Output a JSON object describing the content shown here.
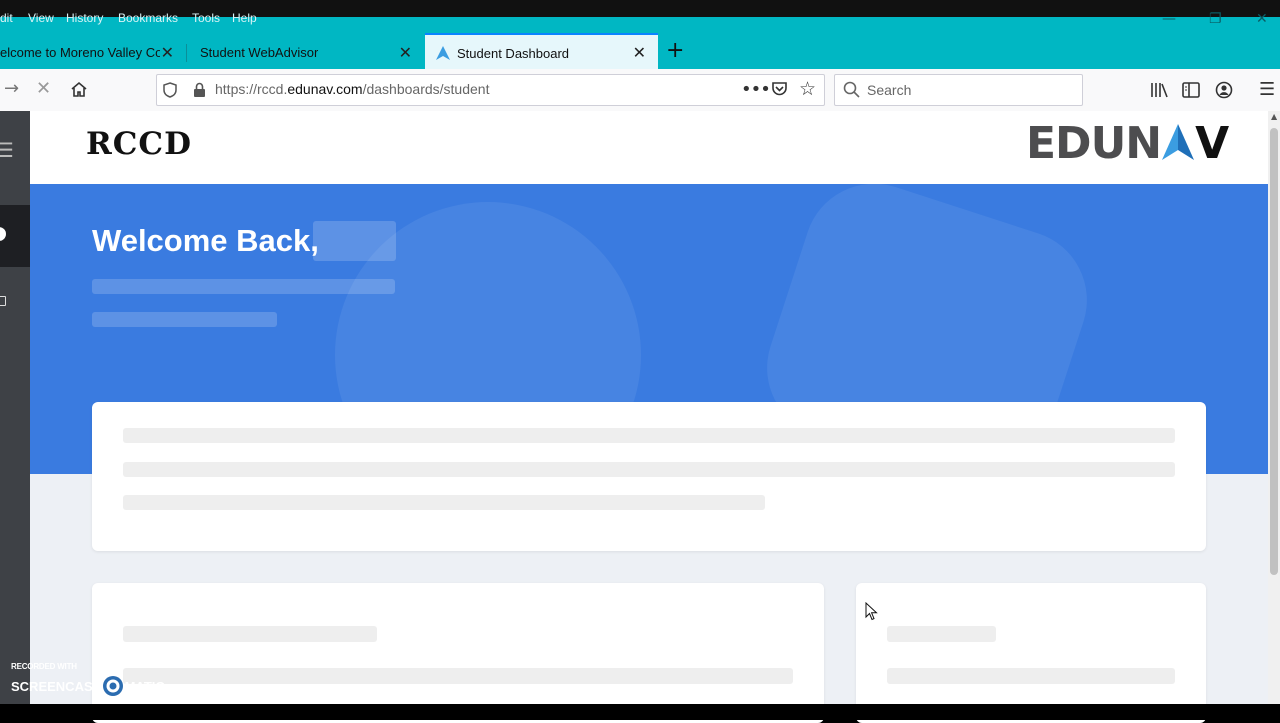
{
  "browser": {
    "menu": [
      "dit",
      "View",
      "History",
      "Bookmarks",
      "Tools",
      "Help"
    ],
    "tabs": [
      {
        "label": "elcome to Moreno Valley Col"
      },
      {
        "label": "Student WebAdvisor"
      },
      {
        "label": "Student Dashboard"
      }
    ],
    "url": {
      "prefix": "https://rccd.",
      "domain": "edunav.com",
      "path": "/dashboards/student"
    },
    "search_placeholder": "Search"
  },
  "page": {
    "left_logo": "RCCD",
    "right_logo": {
      "part1": "EDUN",
      "part2": "V"
    },
    "welcome": "Welcome Back,"
  },
  "watermark": {
    "line1": "RECORDED WITH",
    "left": "SCREENCAST",
    "right": "MATIC"
  },
  "colors": {
    "tab_strip": "#00b7c3",
    "hero": "#3a7be0",
    "page_bg": "#edf0f5",
    "sidebar": "#3e4146",
    "logo_gray": "#4d4d4f",
    "logo_accent": "#3b9de1"
  }
}
